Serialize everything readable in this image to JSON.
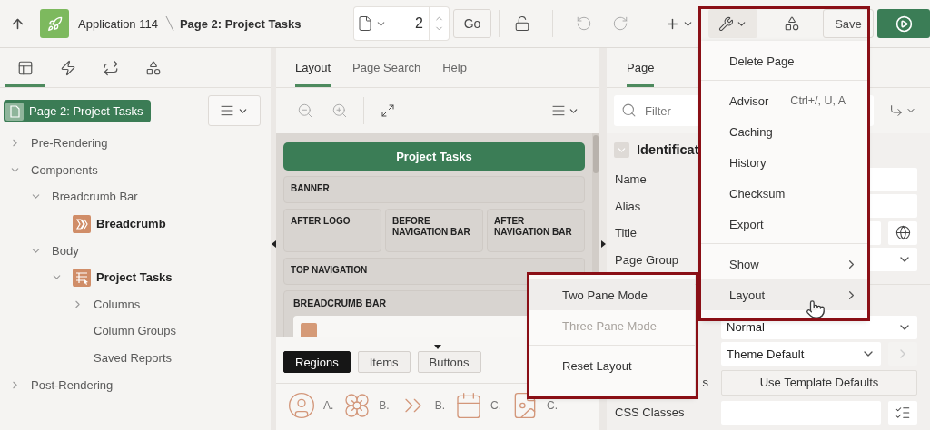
{
  "header": {
    "app": "Application 114",
    "page": "Page 2: Project Tasks",
    "page_number": "2",
    "go": "Go",
    "save": "Save"
  },
  "left": {
    "tabs": [
      {
        "kind": "rendering",
        "selected": true
      },
      {
        "kind": "dynamic_actions",
        "selected": false
      },
      {
        "kind": "processing",
        "selected": false
      },
      {
        "kind": "shared",
        "selected": false
      }
    ],
    "root": {
      "label": "Page 2: Project Tasks",
      "selected": true
    },
    "tree": [
      {
        "label": "Pre-Rendering",
        "expanded": false
      },
      {
        "label": "Components",
        "expanded": true,
        "children": [
          {
            "label": "Breadcrumb Bar",
            "expanded": true,
            "children": [
              {
                "label": "Breadcrumb",
                "kind": "breadcrumb"
              }
            ]
          },
          {
            "label": "Body",
            "expanded": true,
            "children": [
              {
                "label": "Project Tasks",
                "kind": "report",
                "expanded": true,
                "children": [
                  {
                    "label": "Columns",
                    "expanded": false
                  },
                  {
                    "label": "Column Groups"
                  },
                  {
                    "label": "Saved Reports"
                  }
                ]
              }
            ]
          }
        ]
      },
      {
        "label": "Post-Rendering",
        "expanded": false
      }
    ]
  },
  "middle": {
    "tabs": [
      {
        "label": "Layout",
        "selected": true
      },
      {
        "label": "Page Search",
        "selected": false
      },
      {
        "label": "Help",
        "selected": false
      }
    ],
    "canvas": {
      "title": "Project Tasks",
      "rows": [
        [
          {
            "label": "BANNER"
          }
        ],
        [
          {
            "label": "AFTER LOGO"
          },
          {
            "label": "BEFORE NAVIGATION BAR"
          },
          {
            "label": "AFTER NAVIGATION BAR"
          }
        ],
        [
          {
            "label": "TOP NAVIGATION"
          }
        ],
        [
          {
            "label": "BREADCRUMB BAR"
          }
        ]
      ]
    },
    "gallery": {
      "tabs": [
        {
          "label": "Regions",
          "selected": true
        },
        {
          "label": "Items",
          "selected": false
        },
        {
          "label": "Buttons",
          "selected": false
        }
      ],
      "items": [
        {
          "kind": "avatar",
          "label": "A."
        },
        {
          "kind": "badge",
          "label": "B."
        },
        {
          "kind": "breadcrumb",
          "label": "B."
        },
        {
          "kind": "calendar",
          "label": "C."
        },
        {
          "kind": "card",
          "label": "C."
        }
      ]
    }
  },
  "right": {
    "tabs": [
      {
        "label": "Page",
        "selected": true
      }
    ],
    "filter": {
      "placeholder": "Filter"
    },
    "section": {
      "title": "Identificat",
      "expanded": true
    },
    "properties": [
      {
        "kind": "text",
        "label": "Name"
      },
      {
        "kind": "text",
        "label": "Alias"
      },
      {
        "kind": "text_button",
        "label": "Title"
      },
      {
        "kind": "select",
        "label": "Page Group"
      }
    ],
    "properties_2": [
      {
        "kind": "select",
        "value": "Normal"
      },
      {
        "kind": "select_button",
        "value": "Theme Default"
      },
      {
        "kind": "button",
        "label_fragment": "s",
        "value": "Use Template Defaults"
      },
      {
        "kind": "text_list",
        "label": "CSS Classes"
      }
    ]
  },
  "menu": {
    "groups": [
      [
        {
          "label": "Delete Page",
          "highlighted": false
        }
      ],
      [
        {
          "label": "Advisor",
          "shortcut": "Ctrl+/, U, A",
          "highlighted": false
        },
        {
          "label": "Caching",
          "highlighted": false
        },
        {
          "label": "History",
          "highlighted": false
        },
        {
          "label": "Checksum",
          "highlighted": false
        },
        {
          "label": "Export",
          "highlighted": false
        }
      ],
      [
        {
          "label": "Show",
          "submenu": true,
          "highlighted": false
        },
        {
          "label": "Layout",
          "submenu": true,
          "highlighted": true
        }
      ]
    ]
  },
  "submenu": {
    "groups": [
      [
        {
          "label": "Two Pane Mode",
          "highlighted": true,
          "disabled": false
        },
        {
          "label": "Three Pane Mode",
          "highlighted": false,
          "disabled": true
        }
      ],
      [
        {
          "label": "Reset Layout",
          "highlighted": false,
          "disabled": false
        }
      ]
    ]
  }
}
